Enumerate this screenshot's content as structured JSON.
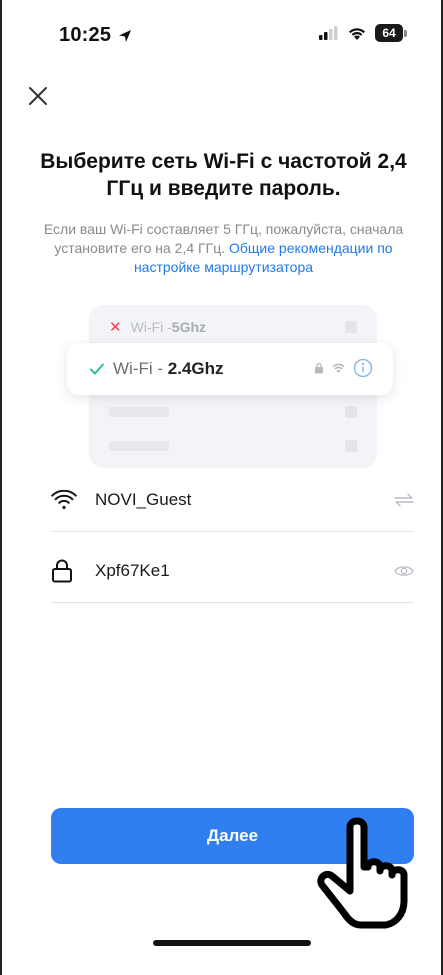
{
  "status_bar": {
    "time": "10:25",
    "battery": "64"
  },
  "header": {
    "close_icon": "close-icon"
  },
  "main": {
    "title": "Выберите сеть Wi-Fi с частотой 2,4 ГГц и введите пароль.",
    "description": "Если ваш Wi-Fi составляет 5 ГГц, пожалуйста, сначала установите его на 2,4 ГГц.",
    "description_link": "Общие рекомендации по настройке маршрутизатора"
  },
  "illustration": {
    "row_5g_prefix": "Wi-Fi - ",
    "row_5g_band": "5Ghz",
    "row_24_prefix": "Wi-Fi - ",
    "row_24_band": "2.4Ghz"
  },
  "form": {
    "ssid_value": "NOVI_Guest",
    "password_value": "Xpf67Ke1"
  },
  "footer": {
    "next_label": "Далее"
  },
  "colors": {
    "accent": "#2f7ff1",
    "link": "#1f7ae8",
    "check": "#2fbf8f",
    "error": "#f0444a"
  }
}
